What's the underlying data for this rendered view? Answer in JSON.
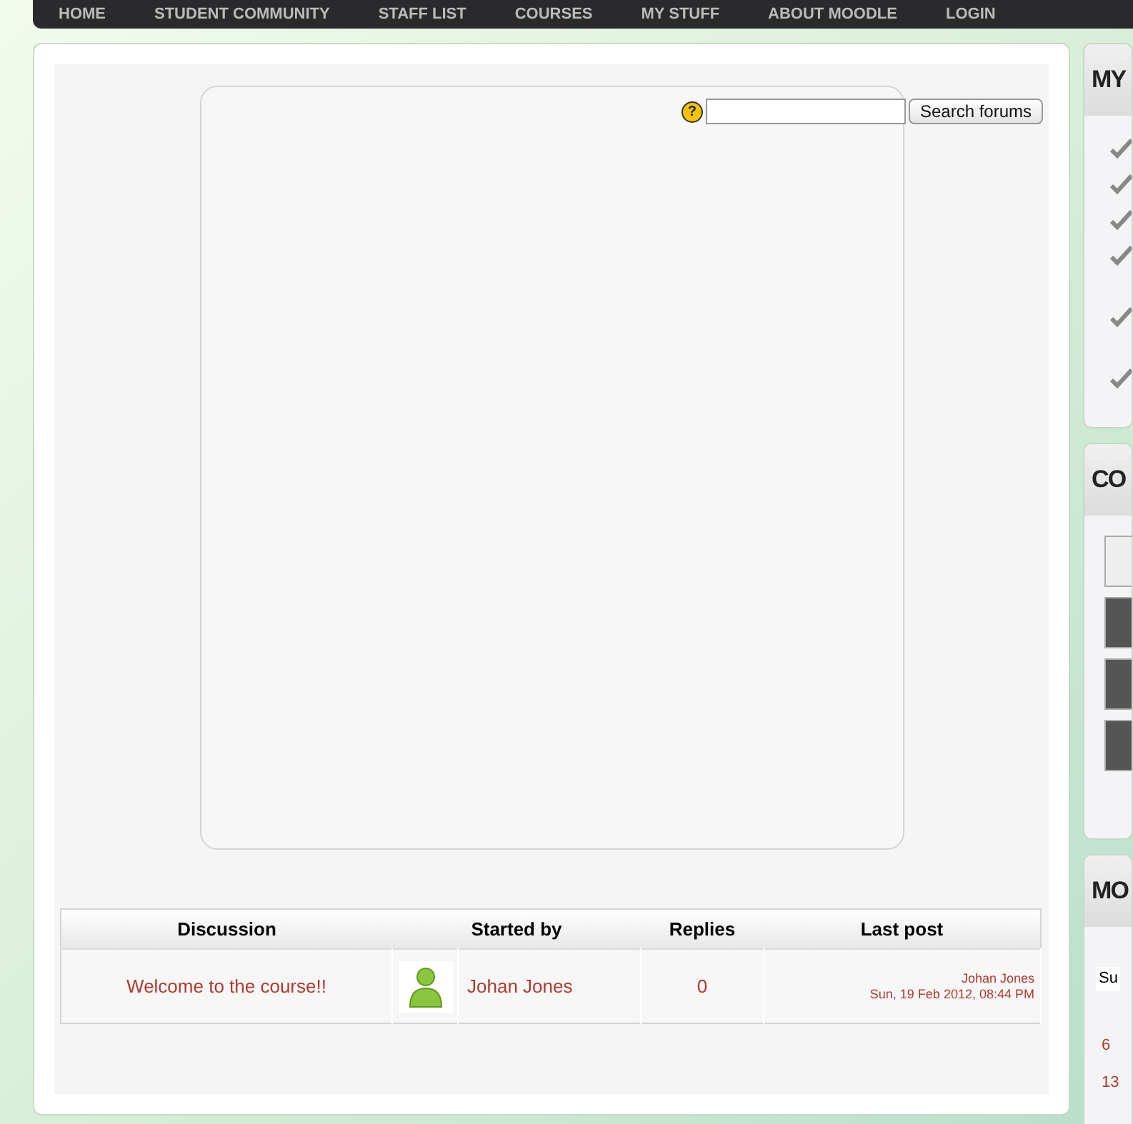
{
  "nav": [
    "HOME",
    "STUDENT COMMUNITY",
    "STAFF LIST",
    "COURSES",
    "MY STUFF",
    "ABOUT MOODLE",
    "LOGIN"
  ],
  "search": {
    "help": "?",
    "button": "Search forums"
  },
  "table": {
    "columns": [
      "Discussion",
      "Started by",
      "Replies",
      "Last post"
    ],
    "rows": [
      {
        "discussion": "Welcome to the course!!",
        "started_by": "Johan Jones",
        "replies": "0",
        "last_post_author": "Johan Jones",
        "last_post_date": "Sun, 19 Feb 2012, 08:44 PM"
      }
    ]
  },
  "sidebar": [
    {
      "title": "MY",
      "kind": "checklist"
    },
    {
      "title": "CO",
      "kind": "people"
    },
    {
      "title": "MO",
      "kind": "calendar",
      "day_header": "Su",
      "dates": [
        "6",
        "13"
      ]
    }
  ]
}
